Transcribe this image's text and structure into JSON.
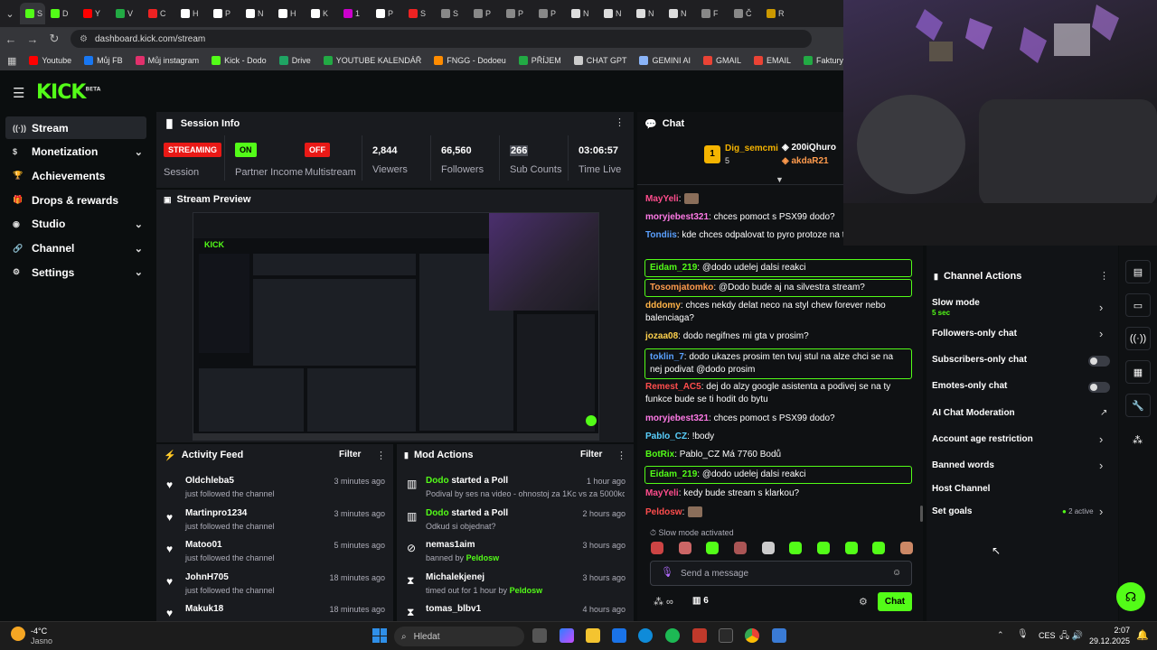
{
  "browser": {
    "tabs": [
      "S",
      "D",
      "Y",
      "V",
      "C",
      "H",
      "P",
      "N",
      "H",
      "K",
      "1",
      "P",
      "S",
      "S",
      "P",
      "P",
      "P",
      "N",
      "N",
      "N",
      "N",
      "F",
      "Č",
      "R"
    ],
    "url": "dashboard.kick.com/stream",
    "bookmarks": [
      "Youtube",
      "Můj FB",
      "Můj instagram",
      "Kick - Dodo",
      "Drive",
      "YOUTUBE KALENDÁŘ",
      "FNGG - Dodoeu",
      "PŘÍJEM",
      "CHAT GPT",
      "GEMINI AI",
      "GMAIL",
      "EMAIL",
      "Faktury - Vytváření",
      "PNG"
    ]
  },
  "brand": {
    "logo": "KICK",
    "beta": "BETA",
    "accent": "#53fc18"
  },
  "sidebar": [
    {
      "label": "Stream",
      "icon": "stream-icon",
      "chevron": false
    },
    {
      "label": "Monetization",
      "icon": "dollar-icon",
      "chevron": true
    },
    {
      "label": "Achievements",
      "icon": "trophy-icon",
      "chevron": false
    },
    {
      "label": "Drops & rewards",
      "icon": "gift-icon",
      "chevron": false
    },
    {
      "label": "Studio",
      "icon": "globe-icon",
      "chevron": true
    },
    {
      "label": "Channel",
      "icon": "link-icon",
      "chevron": true
    },
    {
      "label": "Settings",
      "icon": "gear-icon",
      "chevron": true
    }
  ],
  "session": {
    "title": "Session Info",
    "streaming": "STREAMING",
    "session_label": "Session",
    "partner_badge": "ON",
    "partner_label": "Partner Income",
    "multistream_badge": "OFF",
    "multistream_label": "Multistream",
    "viewers": "2,844",
    "viewers_label": "Viewers",
    "followers": "66,560",
    "followers_label": "Followers",
    "subs": "266",
    "subs_label": "Sub Counts",
    "time": "03:06:57",
    "time_label": "Time Live"
  },
  "preview": {
    "title": "Stream Preview"
  },
  "activity": {
    "title": "Activity Feed",
    "filter": "Filter",
    "items": [
      {
        "name": "Oldchleba5",
        "text": "just followed the channel",
        "time": "3 minutes ago"
      },
      {
        "name": "Martinpro1234",
        "text": "just followed the channel",
        "time": "3 minutes ago"
      },
      {
        "name": "Matoo01",
        "text": "just followed the channel",
        "time": "5 minutes ago"
      },
      {
        "name": "JohnH705",
        "text": "just followed the channel",
        "time": "18 minutes ago"
      },
      {
        "name": "Makuk18",
        "text": "",
        "time": "18 minutes ago"
      }
    ]
  },
  "mod": {
    "title": "Mod Actions",
    "filter": "Filter",
    "items": [
      {
        "user": "Dodo",
        "action": "started a Poll",
        "sub": "Podival by ses na video - ohnostoj za 1Kc vs za 5000kc",
        "time": "1 hour ago"
      },
      {
        "user": "Dodo",
        "action": "started a Poll",
        "sub": "Odkud si objednat?",
        "time": "2 hours ago"
      },
      {
        "user": "nemas1aim",
        "action": "",
        "sub": "banned by",
        "by": "Peldosw",
        "time": "3 hours ago"
      },
      {
        "user": "Michalekjenej",
        "action": "",
        "sub": "timed out for 1 hour by",
        "by": "Peldosw",
        "time": "3 hours ago"
      },
      {
        "user": "tomas_blbv1",
        "action": "",
        "sub": "",
        "time": "4 hours ago"
      }
    ]
  },
  "chat": {
    "title": "Chat",
    "top": {
      "rank": "1",
      "count": "5",
      "user": "Dig_semcmi",
      "u2": "200iQhuro",
      "u3": "akdaR21"
    },
    "messages": [
      {
        "user": "MayYeli",
        "text": "",
        "color": "#ff4d8d",
        "box": false
      },
      {
        "user": "moryjebest321",
        "text": "chces pomoct s PSX99 dodo?",
        "color": "#ff7ae6",
        "box": false
      },
      {
        "user": "Tondiis",
        "text": "kde chces odpalovat to pyro protoze na to zakazany",
        "color": "#5aa0ff",
        "box": false
      },
      {
        "user": "Eidam_219",
        "text": "@dodo udelej dalsi reakci",
        "color": "#53fc18",
        "box": true
      },
      {
        "user": "Tosomjatomko",
        "text": "@Dodo bude aj na silvestra stream?",
        "color": "#ff9b4d",
        "box": true
      },
      {
        "user": "dddomy",
        "text": "chces nekdy delat neco na styl chew forever nebo balenciaga?",
        "color": "#ffb347",
        "box": false
      },
      {
        "user": "jozaa08",
        "text": "dodo negifnes mi gta v prosim?",
        "color": "#ffd24d",
        "box": false
      },
      {
        "user": "toklin_7",
        "text": "dodo ukazes prosim ten tvuj stul na alze chci se na nej podivat @dodo prosim",
        "color": "#5aa0ff",
        "box": true
      },
      {
        "user": "Remest_AC5",
        "text": "dej do alzy google asistenta a podivej se na ty funkce bude se ti hodit do bytu",
        "color": "#ff4d4d",
        "box": false
      },
      {
        "user": "moryjebest321",
        "text": "chces pomoct s PSX99 dodo?",
        "color": "#ff7ae6",
        "box": false
      },
      {
        "user": "Pablo_CZ",
        "text": "!body",
        "color": "#5ad1ff",
        "box": false
      },
      {
        "user": "BotRix",
        "text": "Pablo_CZ Má 7760 Bodů",
        "color": "#53fc18",
        "box": false
      },
      {
        "user": "Eidam_219",
        "text": "@dodo udelej dalsi reakci",
        "color": "#53fc18",
        "box": true
      },
      {
        "user": "MayYeli",
        "text": "kedy bude stream s klarkou?",
        "color": "#ff4d8d",
        "box": false
      },
      {
        "user": "Peldosw",
        "text": "",
        "color": "#ff4d4d",
        "box": false
      }
    ],
    "slow_mode": "Slow mode activated",
    "placeholder": "Send a message",
    "count": "6",
    "send": "Chat"
  },
  "channel_actions": {
    "title": "Channel Actions",
    "items": [
      {
        "label": "Slow mode",
        "sub": "5 sec",
        "kind": "arrow"
      },
      {
        "label": "Followers-only chat",
        "kind": "arrow"
      },
      {
        "label": "Subscribers-only chat",
        "kind": "toggle"
      },
      {
        "label": "Emotes-only chat",
        "kind": "toggle"
      },
      {
        "label": "AI Chat Moderation",
        "kind": "external"
      },
      {
        "label": "Account age restriction",
        "kind": "arrow"
      },
      {
        "label": "Banned words",
        "kind": "arrow"
      },
      {
        "label": "Host Channel",
        "kind": "none"
      },
      {
        "label": "Set goals",
        "kind": "arrow",
        "extra": "2 active"
      }
    ]
  },
  "taskbar": {
    "temp": "-4°C",
    "weather": "Jasno",
    "search": "Hledat",
    "lang": "CES",
    "time": "2:07",
    "date": "29.12.2025"
  }
}
